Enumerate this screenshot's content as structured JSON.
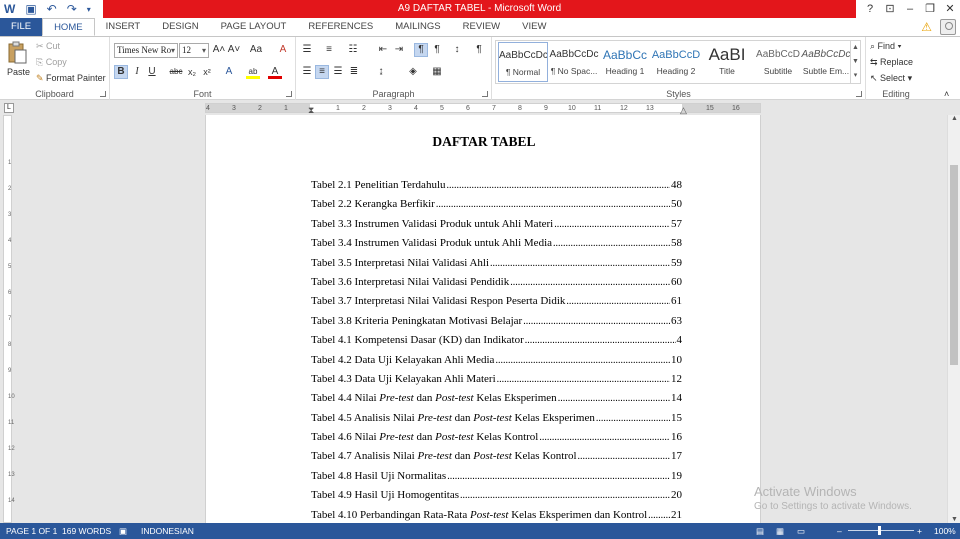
{
  "titlebar": {
    "title": "A9 DAFTAR TABEL  -  Microsoft Word",
    "help": "?",
    "minimize": "–",
    "maximize": "❐",
    "close": "✕",
    "ribbon_options": "⊡"
  },
  "tabs": [
    "FILE",
    "HOME",
    "INSERT",
    "DESIGN",
    "PAGE LAYOUT",
    "REFERENCES",
    "MAILINGS",
    "REVIEW",
    "VIEW"
  ],
  "active_tab": "HOME",
  "clipboard": {
    "label": "Clipboard",
    "paste": "Paste",
    "cut": "Cut",
    "copy": "Copy",
    "format_painter": "Format Painter"
  },
  "font": {
    "label": "Font",
    "family": "Times New Ro",
    "size": "12",
    "bold": "B",
    "italic": "I",
    "underline": "U",
    "strike": "abc",
    "subscript": "x₂",
    "superscript": "x²",
    "grow": "A˄",
    "shrink": "A˅",
    "case": "Aa",
    "clear": "A",
    "effects": "A",
    "highlight": "ab",
    "color": "A"
  },
  "paragraph": {
    "label": "Paragraph"
  },
  "styles": {
    "label": "Styles",
    "items": [
      {
        "sample": "AaBbCcDc",
        "name": "¶ Normal"
      },
      {
        "sample": "AaBbCcDc",
        "name": "¶ No Spac..."
      },
      {
        "sample": "AaBbCc",
        "name": "Heading 1"
      },
      {
        "sample": "AaBbCcD",
        "name": "Heading 2"
      },
      {
        "sample": "AaBI",
        "name": "Title"
      },
      {
        "sample": "AaBbCcD",
        "name": "Subtitle"
      },
      {
        "sample": "AaBbCcDc",
        "name": "Subtle Em..."
      }
    ]
  },
  "editing": {
    "label": "Editing",
    "find": "Find",
    "replace": "Replace",
    "select": "Select"
  },
  "ruler": {
    "ticks": [
      "4",
      "3",
      "2",
      "1",
      "1",
      "2",
      "3",
      "4",
      "5",
      "6",
      "7",
      "8",
      "9",
      "10",
      "11",
      "12",
      "13",
      "14",
      "15",
      "16"
    ],
    "vticks": [
      "1",
      "2",
      "3",
      "4",
      "5",
      "6",
      "7",
      "8",
      "9",
      "10",
      "11",
      "12",
      "13",
      "14"
    ]
  },
  "document": {
    "heading": "DAFTAR TABEL",
    "entries": [
      {
        "parts": [
          {
            "t": "Tabel 2.1 Penelitian Terdahulu"
          }
        ],
        "page": "48"
      },
      {
        "parts": [
          {
            "t": "Tabel 2.2 Kerangka Berfikir "
          }
        ],
        "page": "50"
      },
      {
        "parts": [
          {
            "t": "Tabel 3.3 Instrumen Validasi Produk untuk Ahli Materi "
          }
        ],
        "page": "57"
      },
      {
        "parts": [
          {
            "t": "Tabel 3.4 Instrumen Validasi Produk untuk Ahli Media"
          }
        ],
        "page": "58"
      },
      {
        "parts": [
          {
            "t": "Tabel 3.5 Interpretasi Nilai Validasi Ahli "
          }
        ],
        "page": "59"
      },
      {
        "parts": [
          {
            "t": "Tabel 3.6 Interpretasi Nilai Validasi Pendidik "
          }
        ],
        "page": "60"
      },
      {
        "parts": [
          {
            "t": "Tabel 3.7 Interpretasi Nilai Validasi Respon Peserta Didik "
          }
        ],
        "page": "61"
      },
      {
        "parts": [
          {
            "t": "Tabel 3.8 Kriteria Peningkatan Motivasi Belajar "
          }
        ],
        "page": "63"
      },
      {
        "parts": [
          {
            "t": "Tabel 4.1 Kompetensi Dasar (KD) dan Indikator"
          }
        ],
        "page": "4"
      },
      {
        "parts": [
          {
            "t": "Tabel 4.2 Data Uji Kelayakan Ahli Media "
          }
        ],
        "page": "10"
      },
      {
        "parts": [
          {
            "t": "Tabel 4.3 Data Uji Kelayakan Ahli Materi"
          }
        ],
        "page": "12"
      },
      {
        "parts": [
          {
            "t": "Tabel 4.4 Nilai "
          },
          {
            "t": "Pre-test",
            "i": true
          },
          {
            "t": " dan "
          },
          {
            "t": "Post-test",
            "i": true
          },
          {
            "t": " Kelas Eksperimen "
          }
        ],
        "page": "14"
      },
      {
        "parts": [
          {
            "t": "Tabel 4.5 Analisis Nilai "
          },
          {
            "t": "Pre-test",
            "i": true
          },
          {
            "t": " dan "
          },
          {
            "t": "Post-test",
            "i": true
          },
          {
            "t": " Kelas Eksperimen "
          }
        ],
        "page": "15"
      },
      {
        "parts": [
          {
            "t": "Tabel 4.6 Nilai "
          },
          {
            "t": "Pre-test",
            "i": true
          },
          {
            "t": " dan "
          },
          {
            "t": "Post-test",
            "i": true
          },
          {
            "t": " Kelas Kontrol "
          }
        ],
        "page": "16"
      },
      {
        "parts": [
          {
            "t": "Tabel 4.7 Analisis Nilai "
          },
          {
            "t": "Pre-test",
            "i": true
          },
          {
            "t": " dan "
          },
          {
            "t": "Post-test",
            "i": true
          },
          {
            "t": " Kelas Kontrol "
          }
        ],
        "page": "17"
      },
      {
        "parts": [
          {
            "t": "Tabel 4.8 Hasil Uji Normalitas"
          }
        ],
        "page": "19"
      },
      {
        "parts": [
          {
            "t": "Tabel 4.9 Hasil Uji Homogentitas "
          }
        ],
        "page": "20"
      },
      {
        "parts": [
          {
            "t": "Tabel 4.10 Perbandingan Rata-Rata "
          },
          {
            "t": "Post-test",
            "i": true
          },
          {
            "t": " Kelas Eksperimen dan Kontrol"
          }
        ],
        "page": "21"
      }
    ]
  },
  "watermark": {
    "line1": "Activate Windows",
    "line2": "Go to Settings to activate Windows."
  },
  "status": {
    "page": "PAGE 1 OF 1",
    "words": "169 WORDS",
    "language": "INDONESIAN",
    "zoom": "100%",
    "zoom_minus": "–",
    "zoom_plus": "+"
  }
}
